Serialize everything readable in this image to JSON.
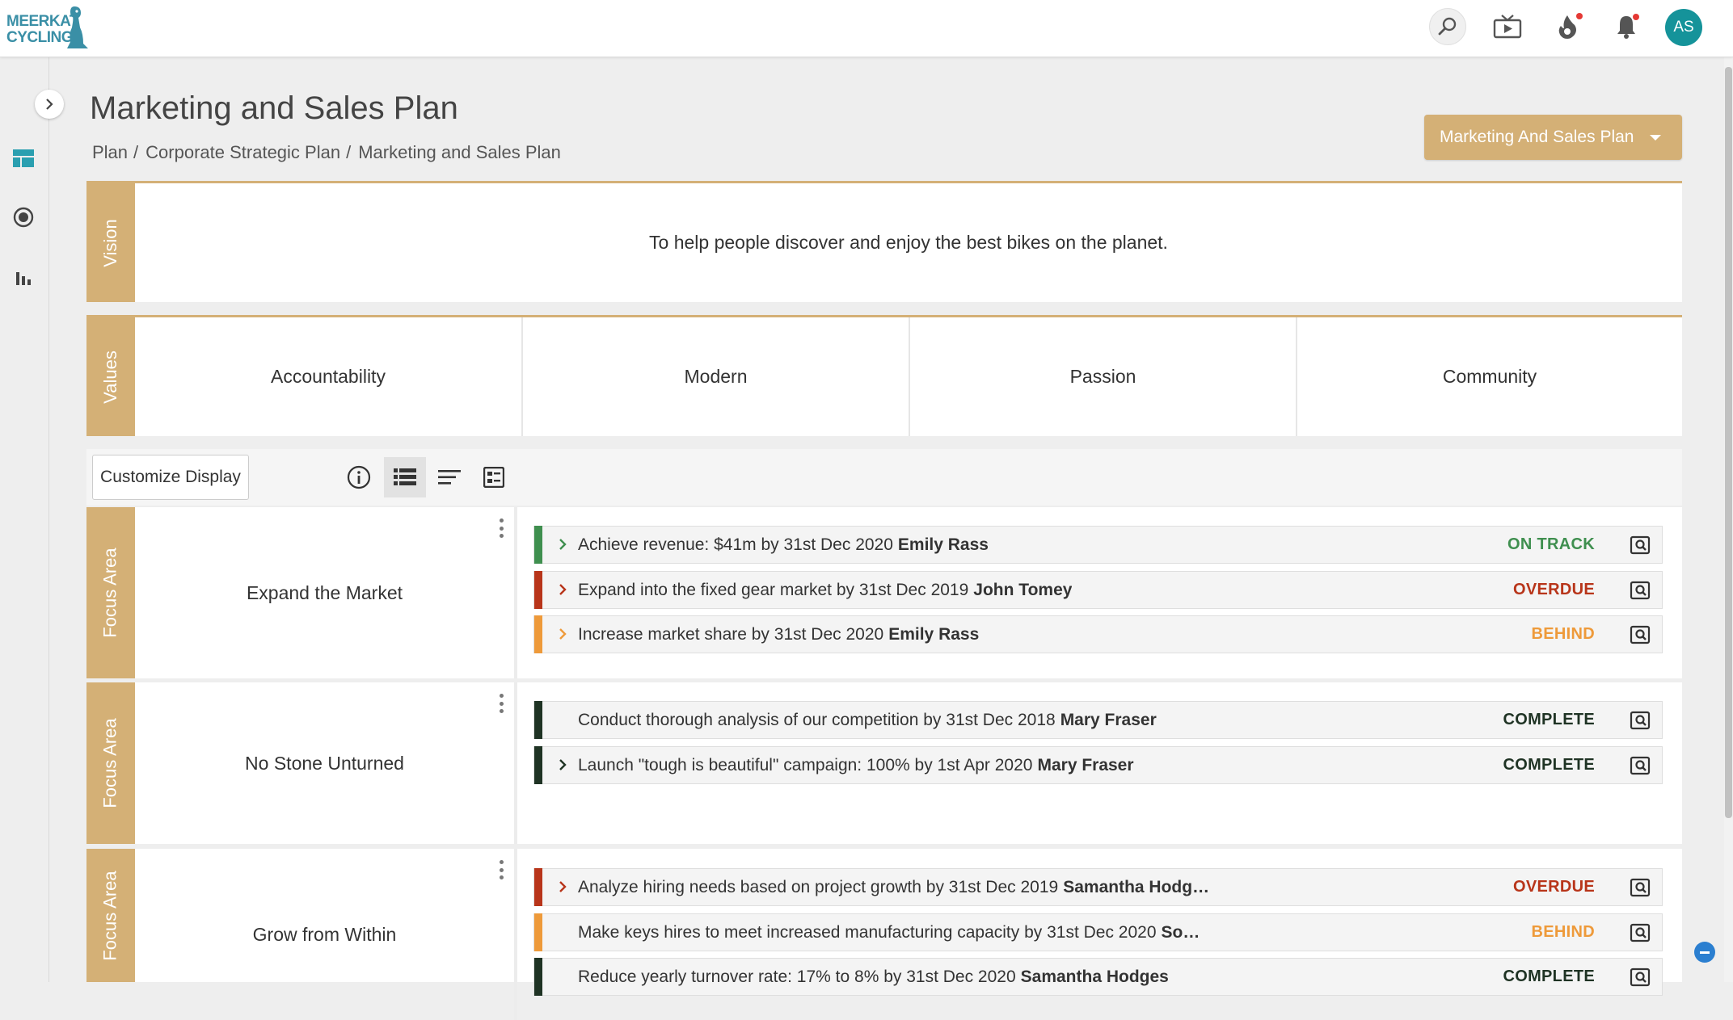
{
  "app": {
    "logo_line1": "MEERKAT",
    "logo_line2": "CYCLING",
    "avatar_initials": "AS"
  },
  "header": {
    "title": "Marketing and Sales Plan",
    "breadcrumb": [
      "Plan",
      "Corporate Strategic Plan",
      "Marketing and Sales Plan"
    ],
    "breadcrumb_separator": "/",
    "plan_selector": "Marketing And Sales Plan"
  },
  "vision": {
    "label": "Vision",
    "text": "To help people discover and enjoy the best bikes on the planet."
  },
  "values": {
    "label": "Values",
    "items": [
      "Accountability",
      "Modern",
      "Passion",
      "Community"
    ]
  },
  "toolbar": {
    "customize_label": "Customize Display",
    "icons": [
      "info-icon",
      "list-view-icon",
      "compact-view-icon",
      "card-view-icon"
    ]
  },
  "focus_areas": [
    {
      "label": "Focus Area",
      "name": "Expand the Market",
      "objectives": [
        {
          "text": "Achieve revenue: $41m by 31st Dec 2020",
          "owner": "Emily Rass",
          "status": "ON TRACK",
          "color": "#3f8f4f",
          "expandable": true
        },
        {
          "text": "Expand into the fixed gear market by 31st Dec 2019",
          "owner": "John Tomey",
          "status": "OVERDUE",
          "color": "#b8351a",
          "expandable": true
        },
        {
          "text": "Increase market share by 31st Dec 2020",
          "owner": "Emily Rass",
          "status": "BEHIND",
          "color": "#ee9a3a",
          "expandable": true
        }
      ]
    },
    {
      "label": "Focus Area",
      "name": "No Stone Unturned",
      "objectives": [
        {
          "text": "Conduct thorough analysis of our competition by 31st Dec 2018",
          "owner": "Mary Fraser",
          "status": "COMPLETE",
          "color": "#1f3324",
          "expandable": false
        },
        {
          "text": "Launch \"tough is beautiful\" campaign: 100% by 1st Apr 2020",
          "owner": "Mary Fraser",
          "status": "COMPLETE",
          "color": "#1f3324",
          "expandable": true
        }
      ]
    },
    {
      "label": "Focus Area",
      "name": "Grow from Within",
      "objectives": [
        {
          "text": "Analyze hiring needs based on project growth by 31st Dec 2019",
          "owner": "Samantha Hodg…",
          "status": "OVERDUE",
          "color": "#b8351a",
          "expandable": true
        },
        {
          "text": "Make keys hires to meet increased manufacturing capacity by 31st Dec 2020",
          "owner": "So…",
          "status": "BEHIND",
          "color": "#ee9a3a",
          "expandable": false
        },
        {
          "text": "Reduce yearly turnover rate: 17% to 8% by 31st Dec 2020",
          "owner": "Samantha Hodges",
          "status": "COMPLETE",
          "color": "#1f3324",
          "expandable": false
        }
      ]
    }
  ],
  "colors": {
    "accent": "#d4b076",
    "on_track": "#3f8f4f",
    "overdue": "#b8351a",
    "behind": "#ee9a3a",
    "complete": "#1f3324",
    "avatar": "#15939a"
  }
}
